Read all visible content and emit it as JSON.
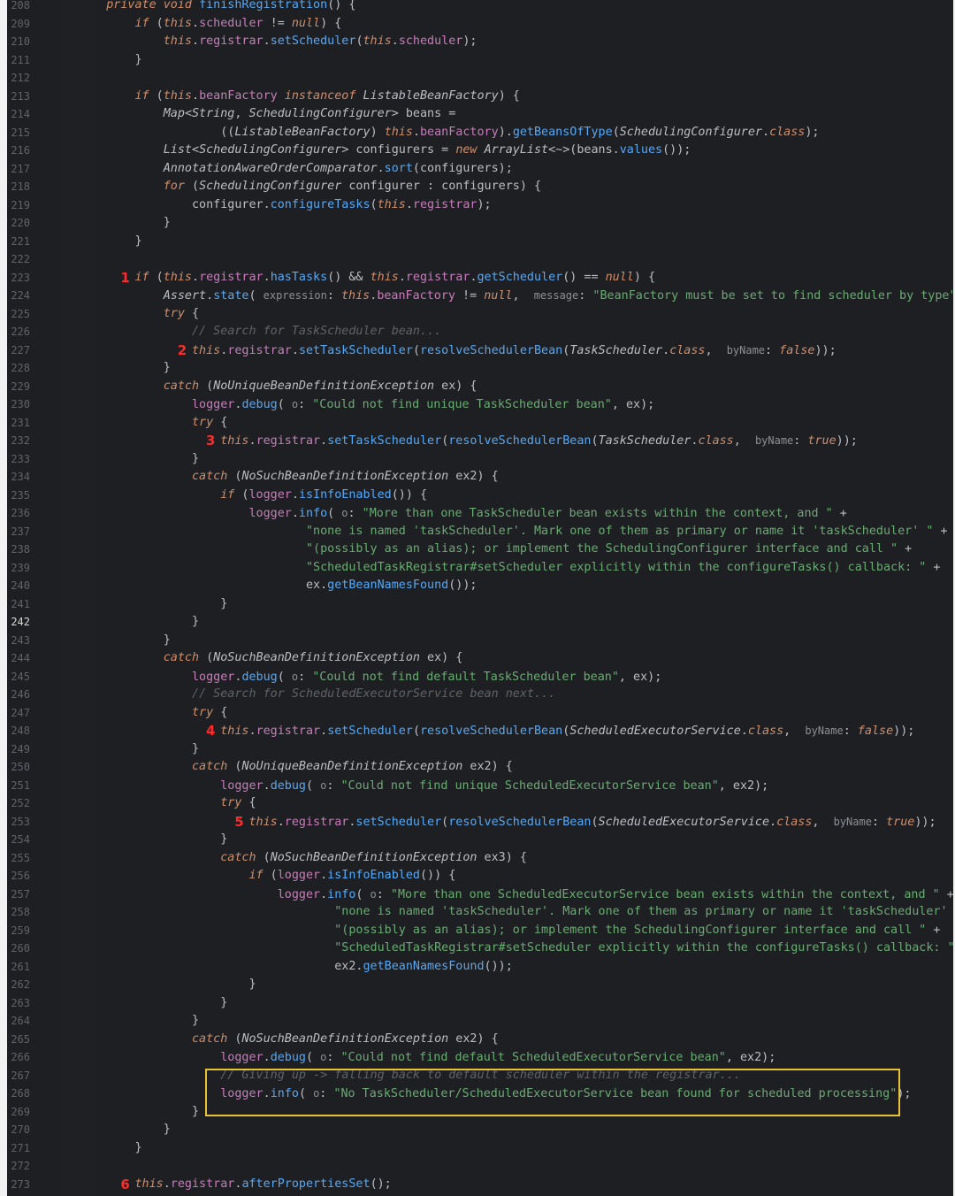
{
  "editor": {
    "current_line": 242,
    "highlight_color": "#e8c33a",
    "marker_color": "#ff2a2a",
    "lines": [
      {
        "n": "208",
        "code": "    private void finishRegistration() {"
      },
      {
        "n": "209",
        "code": "        if (this.scheduler != null) {"
      },
      {
        "n": "210",
        "code": "            this.registrar.setScheduler(this.scheduler);"
      },
      {
        "n": "211",
        "code": "        }"
      },
      {
        "n": "212",
        "code": ""
      },
      {
        "n": "213",
        "code": "        if (this.beanFactory instanceof ListableBeanFactory) {"
      },
      {
        "n": "214",
        "code": "            Map<String, SchedulingConfigurer> beans ="
      },
      {
        "n": "215",
        "code": "                    ((ListableBeanFactory) this.beanFactory).getBeansOfType(SchedulingConfigurer.class);"
      },
      {
        "n": "216",
        "code": "            List<SchedulingConfigurer> configurers = new ArrayList<~>(beans.values());"
      },
      {
        "n": "217",
        "code": "            AnnotationAwareOrderComparator.sort(configurers);"
      },
      {
        "n": "218",
        "code": "            for (SchedulingConfigurer configurer : configurers) {"
      },
      {
        "n": "219",
        "code": "                configurer.configureTasks(this.registrar);"
      },
      {
        "n": "220",
        "code": "            }"
      },
      {
        "n": "221",
        "code": "        }"
      },
      {
        "n": "222",
        "code": ""
      },
      {
        "n": "223",
        "code": "        if (this.registrar.hasTasks() && this.registrar.getScheduler() == null) {"
      },
      {
        "n": "224",
        "code": "            Assert.state( expression: this.beanFactory != null,  message: \"BeanFactory must be set to find scheduler by type\");"
      },
      {
        "n": "225",
        "code": "            try {"
      },
      {
        "n": "226",
        "code": "                // Search for TaskScheduler bean..."
      },
      {
        "n": "227",
        "code": "                this.registrar.setTaskScheduler(resolveSchedulerBean(TaskScheduler.class,  byName: false));"
      },
      {
        "n": "228",
        "code": "            }"
      },
      {
        "n": "229",
        "code": "            catch (NoUniqueBeanDefinitionException ex) {"
      },
      {
        "n": "230",
        "code": "                logger.debug( o: \"Could not find unique TaskScheduler bean\", ex);"
      },
      {
        "n": "231",
        "code": "                try {"
      },
      {
        "n": "232",
        "code": "                    this.registrar.setTaskScheduler(resolveSchedulerBean(TaskScheduler.class,  byName: true));"
      },
      {
        "n": "233",
        "code": "                }"
      },
      {
        "n": "234",
        "code": "                catch (NoSuchBeanDefinitionException ex2) {"
      },
      {
        "n": "235",
        "code": "                    if (logger.isInfoEnabled()) {"
      },
      {
        "n": "236",
        "code": "                        logger.info( o: \"More than one TaskScheduler bean exists within the context, and \" +"
      },
      {
        "n": "237",
        "code": "                                \"none is named 'taskScheduler'. Mark one of them as primary or name it 'taskScheduler' \" +"
      },
      {
        "n": "238",
        "code": "                                \"(possibly as an alias); or implement the SchedulingConfigurer interface and call \" +"
      },
      {
        "n": "239",
        "code": "                                \"ScheduledTaskRegistrar#setScheduler explicitly within the configureTasks() callback: \" +"
      },
      {
        "n": "240",
        "code": "                                ex.getBeanNamesFound());"
      },
      {
        "n": "241",
        "code": "                    }"
      },
      {
        "n": "242",
        "code": "                }"
      },
      {
        "n": "243",
        "code": "            }"
      },
      {
        "n": "244",
        "code": "            catch (NoSuchBeanDefinitionException ex) {"
      },
      {
        "n": "245",
        "code": "                logger.debug( o: \"Could not find default TaskScheduler bean\", ex);"
      },
      {
        "n": "246",
        "code": "                // Search for ScheduledExecutorService bean next..."
      },
      {
        "n": "247",
        "code": "                try {"
      },
      {
        "n": "248",
        "code": "                    this.registrar.setScheduler(resolveSchedulerBean(ScheduledExecutorService.class,  byName: false));"
      },
      {
        "n": "249",
        "code": "                }"
      },
      {
        "n": "250",
        "code": "                catch (NoUniqueBeanDefinitionException ex2) {"
      },
      {
        "n": "251",
        "code": "                    logger.debug( o: \"Could not find unique ScheduledExecutorService bean\", ex2);"
      },
      {
        "n": "252",
        "code": "                    try {"
      },
      {
        "n": "253",
        "code": "                        this.registrar.setScheduler(resolveSchedulerBean(ScheduledExecutorService.class,  byName: true));"
      },
      {
        "n": "254",
        "code": "                    }"
      },
      {
        "n": "255",
        "code": "                    catch (NoSuchBeanDefinitionException ex3) {"
      },
      {
        "n": "256",
        "code": "                        if (logger.isInfoEnabled()) {"
      },
      {
        "n": "257",
        "code": "                            logger.info( o: \"More than one ScheduledExecutorService bean exists within the context, and \" +"
      },
      {
        "n": "258",
        "code": "                                    \"none is named 'taskScheduler'. Mark one of them as primary or name it 'taskScheduler' \" +"
      },
      {
        "n": "259",
        "code": "                                    \"(possibly as an alias); or implement the SchedulingConfigurer interface and call \" +"
      },
      {
        "n": "260",
        "code": "                                    \"ScheduledTaskRegistrar#setScheduler explicitly within the configureTasks() callback: \" +"
      },
      {
        "n": "261",
        "code": "                                    ex2.getBeanNamesFound());"
      },
      {
        "n": "262",
        "code": "                        }"
      },
      {
        "n": "263",
        "code": "                    }"
      },
      {
        "n": "264",
        "code": "                }"
      },
      {
        "n": "265",
        "code": "                catch (NoSuchBeanDefinitionException ex2) {"
      },
      {
        "n": "266",
        "code": "                    logger.debug( o: \"Could not find default ScheduledExecutorService bean\", ex2);"
      },
      {
        "n": "267",
        "code": "                    // Giving up -> falling back to default scheduler within the registrar..."
      },
      {
        "n": "268",
        "code": "                    logger.info( o: \"No TaskScheduler/ScheduledExecutorService bean found for scheduled processing\");"
      },
      {
        "n": "269",
        "code": "                }"
      },
      {
        "n": "270",
        "code": "            }"
      },
      {
        "n": "271",
        "code": "        }"
      },
      {
        "n": "272",
        "code": ""
      },
      {
        "n": "273",
        "code": "        this.registrar.afterPropertiesSet();"
      }
    ],
    "markers": [
      {
        "label": "1",
        "line_index": 15
      },
      {
        "label": "2",
        "line_index": 19
      },
      {
        "label": "3",
        "line_index": 24
      },
      {
        "label": "4",
        "line_index": 40
      },
      {
        "label": "5",
        "line_index": 45
      },
      {
        "label": "6",
        "line_index": 65
      }
    ]
  }
}
